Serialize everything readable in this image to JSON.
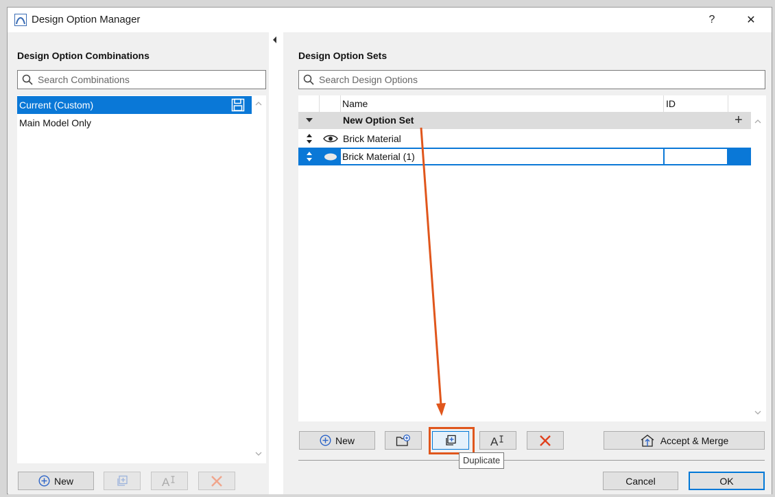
{
  "window": {
    "title": "Design Option Manager",
    "help_label": "?",
    "close_label": "✕"
  },
  "left": {
    "section_title": "Design Option Combinations",
    "search_placeholder": "Search Combinations",
    "items": [
      {
        "label": "Current (Custom)",
        "selected": true
      },
      {
        "label": "Main Model Only",
        "selected": false
      }
    ],
    "buttons": {
      "new_label": "New"
    }
  },
  "right": {
    "section_title": "Design Option Sets",
    "search_placeholder": "Search Design Options",
    "table": {
      "columns": [
        "Name",
        "ID"
      ],
      "group": {
        "label": "New Option Set",
        "add_label": "+"
      },
      "rows": [
        {
          "name": "Brick Material",
          "id": "",
          "selected": false,
          "visibility": "eye-icon"
        },
        {
          "name": "Brick Material (1)",
          "id": "",
          "selected": true,
          "visibility": "hidden-eye-icon"
        }
      ]
    },
    "buttons": {
      "new_label": "New",
      "accept_merge_label": "Accept & Merge",
      "cancel_label": "Cancel",
      "ok_label": "OK"
    },
    "tooltip": "Duplicate"
  },
  "colors": {
    "selection": "#0a78d7",
    "annotation": "#e0561c",
    "delete_red": "#e0401c"
  }
}
